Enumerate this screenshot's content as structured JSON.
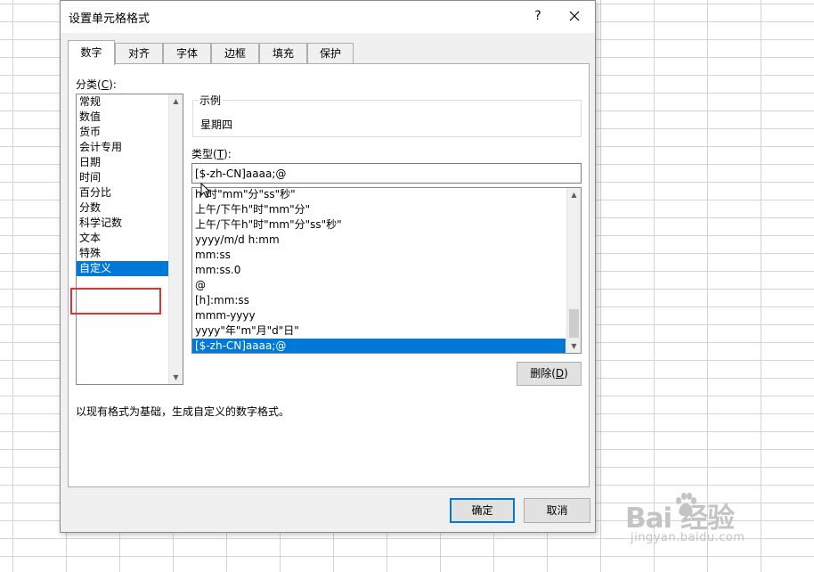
{
  "dialog": {
    "title": "设置单元格格式",
    "help_glyph": "?",
    "close_icon": "close-icon"
  },
  "tabs": [
    {
      "label": "数字",
      "active": true
    },
    {
      "label": "对齐",
      "active": false
    },
    {
      "label": "字体",
      "active": false
    },
    {
      "label": "边框",
      "active": false
    },
    {
      "label": "填充",
      "active": false
    },
    {
      "label": "保护",
      "active": false
    }
  ],
  "category": {
    "label_prefix": "分类(",
    "label_key": "C",
    "label_suffix": "):",
    "items": [
      "常规",
      "数值",
      "货币",
      "会计专用",
      "日期",
      "时间",
      "百分比",
      "分数",
      "科学记数",
      "文本",
      "特殊",
      "自定义"
    ],
    "selected": "自定义"
  },
  "sample": {
    "legend": "示例",
    "value": "星期四"
  },
  "type": {
    "label_prefix": "类型(",
    "label_key": "T",
    "label_suffix": "):",
    "input_value": "[$-zh-CN]aaaa;@",
    "formats": [
      "h\"时\"mm\"分\"ss\"秒\"",
      "上午/下午h\"时\"mm\"分\"",
      "上午/下午h\"时\"mm\"分\"ss\"秒\"",
      "yyyy/m/d h:mm",
      "mm:ss",
      "mm:ss.0",
      "@",
      "[h]:mm:ss",
      "mmm-yyyy",
      "yyyy\"年\"m\"月\"d\"日\"",
      "[$-zh-CN]aaaa;@"
    ],
    "selected": "[$-zh-CN]aaaa;@"
  },
  "delete_button": {
    "label_prefix": "删除(",
    "label_key": "D",
    "label_suffix": ")"
  },
  "description": "以现有格式为基础，生成自定义的数字格式。",
  "buttons": {
    "ok": "确定",
    "cancel": "取消"
  },
  "colors": {
    "selection": "#0078d7",
    "highlight_box": "#e0332e",
    "dialog_bg": "#f0f0f0"
  },
  "watermark": {
    "text": "Bai  经验",
    "url": "jingyan.baidu.com"
  }
}
